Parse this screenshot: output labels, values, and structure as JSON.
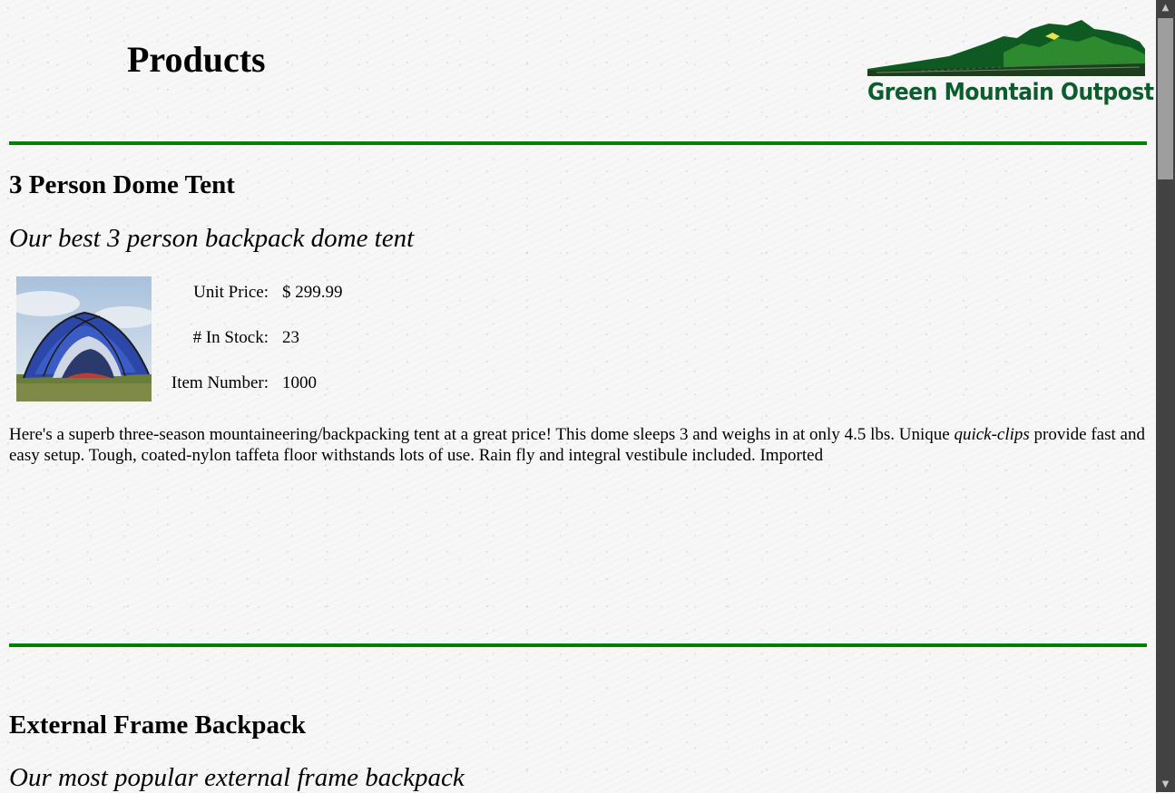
{
  "header": {
    "title": "Products",
    "logo_text": "Green Mountain Outpost"
  },
  "products": [
    {
      "name": "3 Person Dome Tent",
      "tagline": "Our best 3 person backpack dome tent",
      "image_icon": "tent-photo",
      "specs": [
        {
          "label": "Unit Price:",
          "value": "$ 299.99"
        },
        {
          "label": "# In Stock:",
          "value": "23"
        },
        {
          "label": "Item Number:",
          "value": "1000"
        }
      ],
      "description_before": "Here's a superb three-season mountaineering/backpacking tent at a great price! This dome sleeps 3 and weighs in at only 4.5 lbs. Unique ",
      "description_em": "quick-clips",
      "description_after": " provide fast and easy setup. Tough, coated-nylon taffeta floor withstands lots of use. Rain fly and integral vestibule included. Imported"
    },
    {
      "name": "External Frame Backpack",
      "tagline": "Our most popular external frame backpack"
    }
  ],
  "colors": {
    "rule": "#008000",
    "logo_text": "#0d5c2d",
    "scrollbar_track": "#424242",
    "scrollbar_thumb": "#9e9e9e"
  },
  "scrollbar": {
    "up_icon": "arrow-up-icon",
    "down_icon": "arrow-down-icon"
  }
}
